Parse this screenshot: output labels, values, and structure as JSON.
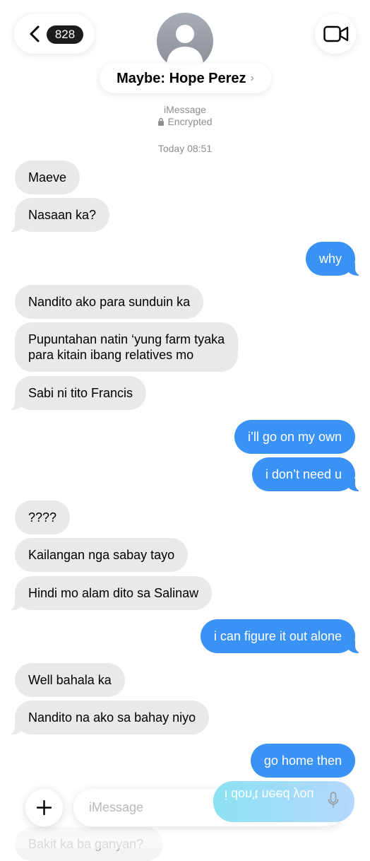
{
  "header": {
    "unread_count": "828",
    "contact_name": "Maybe: Hope Perez",
    "name_chevron": "›",
    "service": "iMessage",
    "encryption": "Encrypted",
    "icons": [
      "chevron-left-icon",
      "video-camera-icon",
      "person-icon",
      "lock-icon",
      "chevron-right-icon"
    ]
  },
  "thread": {
    "timestamp": "Today 08:51",
    "messages": [
      {
        "from": "them",
        "text": "Maeve"
      },
      {
        "from": "them",
        "text": "Nasaan ka?"
      },
      {
        "from": "me",
        "text": "why"
      },
      {
        "from": "them",
        "text": "Nandito ako para sunduin ka"
      },
      {
        "from": "them",
        "lines": [
          "Pupuntahan natin ‘yung farm tyaka",
          "para kitain ibang relatives mo"
        ]
      },
      {
        "from": "them",
        "text": "Sabi ni tito Francis"
      },
      {
        "from": "me",
        "text": "i’ll go on my own"
      },
      {
        "from": "me",
        "text": "i don’t need u"
      },
      {
        "from": "them",
        "text": "????"
      },
      {
        "from": "them",
        "text": "Kailangan nga sabay tayo"
      },
      {
        "from": "them",
        "text": "Hindi mo alam dito sa Salinaw"
      },
      {
        "from": "me",
        "text": "i can figure it out alone"
      },
      {
        "from": "them",
        "text": "Well bahala ka"
      },
      {
        "from": "them",
        "text": "Nandito na ako sa bahay niyo"
      },
      {
        "from": "me",
        "text": "go home then"
      },
      {
        "from": "me",
        "text": "i don't need you"
      },
      {
        "from": "them",
        "text": "Bakit ka ba ganyan?"
      }
    ]
  },
  "composer": {
    "placeholder": "iMessage",
    "icons": [
      "plus-icon",
      "microphone-icon"
    ]
  },
  "colors": {
    "outgoing": "#3b92f5",
    "incoming": "#e9e9eb",
    "meta_text": "#8e8e93"
  }
}
